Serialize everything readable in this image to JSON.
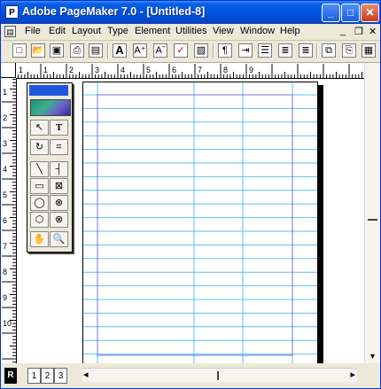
{
  "window": {
    "title": "Adobe PageMaker 7.0 - [Untitled-8]",
    "controls": {
      "minimize": "_",
      "maximize": "□",
      "close": "✕"
    }
  },
  "menubar": {
    "items": [
      "File",
      "Edit",
      "Layout",
      "Type",
      "Element",
      "Utilities",
      "View",
      "Window",
      "Help"
    ],
    "mdi": {
      "minimize": "_",
      "restore": "❐",
      "close": "✕"
    }
  },
  "toolbar": {
    "buttons": [
      {
        "name": "new-document-icon",
        "glyph": "□"
      },
      {
        "name": "open-folder-icon",
        "glyph": "📂"
      },
      {
        "name": "save-disk-icon",
        "glyph": "▣"
      },
      {
        "name": "print-icon",
        "glyph": "⎙"
      },
      {
        "name": "find-icon",
        "glyph": "▤"
      },
      {
        "name": "story-editor-icon",
        "glyph": "≡"
      },
      {
        "name": "font-a-icon",
        "glyph": "A"
      },
      {
        "name": "font-increase-icon",
        "glyph": "A⁺"
      },
      {
        "name": "font-decrease-icon",
        "glyph": "Aˉ"
      },
      {
        "name": "spell-check-icon",
        "glyph": "✓"
      },
      {
        "name": "image-icon",
        "glyph": "▨"
      },
      {
        "name": "paragraph-icon",
        "glyph": "¶"
      },
      {
        "name": "indent-icon",
        "glyph": "⇥"
      },
      {
        "name": "bullets-icon",
        "glyph": "☰"
      },
      {
        "name": "align-left-icon",
        "glyph": "≣"
      },
      {
        "name": "align-right-icon",
        "glyph": "≣"
      },
      {
        "name": "copy-icon",
        "glyph": "⧉"
      },
      {
        "name": "paste-icon",
        "glyph": "⎘"
      },
      {
        "name": "properties-icon",
        "glyph": "▦"
      }
    ]
  },
  "rulers": {
    "horizontal_labels": [
      "1",
      "1",
      "2",
      "3",
      "4",
      "5",
      "6",
      "7",
      "8",
      "9"
    ],
    "vertical_labels": [
      "1",
      "2",
      "3",
      "4",
      "5",
      "6",
      "7",
      "8",
      "9",
      "10"
    ]
  },
  "toolbox": {
    "tools": [
      {
        "name": "pointer-tool-icon",
        "glyph": "↖"
      },
      {
        "name": "text-tool-icon",
        "glyph": "T"
      },
      {
        "name": "rotate-tool-icon",
        "glyph": "↻"
      },
      {
        "name": "crop-tool-icon",
        "glyph": "⌗"
      },
      {
        "name": "line-tool-icon",
        "glyph": "╲"
      },
      {
        "name": "constrained-line-tool-icon",
        "glyph": "┤"
      },
      {
        "name": "rectangle-frame-tool-icon",
        "glyph": "▭"
      },
      {
        "name": "rectangle-tool-icon",
        "glyph": "⊠"
      },
      {
        "name": "ellipse-frame-tool-icon",
        "glyph": "◯"
      },
      {
        "name": "ellipse-tool-icon",
        "glyph": "⊗"
      },
      {
        "name": "polygon-frame-tool-icon",
        "glyph": "⬡"
      },
      {
        "name": "polygon-tool-icon",
        "glyph": "⊗"
      },
      {
        "name": "hand-tool-icon",
        "glyph": "✋"
      },
      {
        "name": "zoom-tool-icon",
        "glyph": "🔍"
      }
    ]
  },
  "page_tabs": [
    "R",
    "1",
    "2",
    "3"
  ],
  "scroll": {
    "left_arrow": "◂",
    "right_arrow": "▸",
    "down_arrow": "▾"
  },
  "colors": {
    "guide_blue": "#5bc0ee",
    "margin_purple": "#7b6fd6",
    "title_blue": "#0054e3",
    "toolbox_header": "#1e56e0"
  }
}
